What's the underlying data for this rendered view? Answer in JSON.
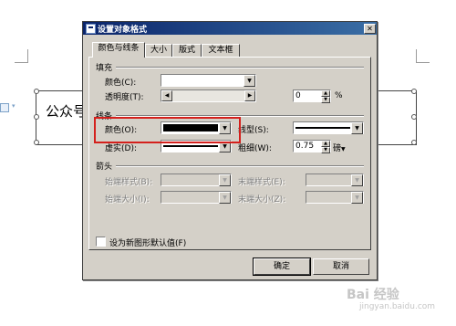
{
  "document": {
    "shape_text": "公众号"
  },
  "dialog": {
    "title": "设置对象格式",
    "close_glyph": "✕",
    "tabs": [
      {
        "label": "颜色与线条",
        "active": true
      },
      {
        "label": "大小",
        "active": false
      },
      {
        "label": "版式",
        "active": false
      },
      {
        "label": "文本框",
        "active": false
      }
    ],
    "fill": {
      "section_label": "填充",
      "color_label": "颜色(C):",
      "color_value": "#ffffff",
      "transparency_label": "透明度(T):",
      "transparency_value": "0",
      "transparency_unit": "%"
    },
    "line": {
      "section_label": "线条",
      "color_label": "颜色(O):",
      "color_value": "#000000",
      "type_label": "线型(S):",
      "dash_label": "虚实(D):",
      "weight_label": "粗细(W):",
      "weight_value": "0.75",
      "weight_unit": "磅"
    },
    "arrows": {
      "section_label": "箭头",
      "begin_style_label": "始端样式(B):",
      "end_style_label": "末端样式(E):",
      "begin_size_label": "始端大小(I):",
      "end_size_label": "末端大小(Z):"
    },
    "default_checkbox_label": "设为新图形默认值(F)",
    "default_checkbox_checked": false,
    "ok_label": "确定",
    "cancel_label": "取消"
  },
  "watermark": {
    "text": "Bai 经验",
    "sub": "jingyan.baidu.com"
  },
  "colors": {
    "highlight": "#d4201c",
    "title_bar": "#0a246a",
    "dialog_bg": "#d4d0c8"
  }
}
